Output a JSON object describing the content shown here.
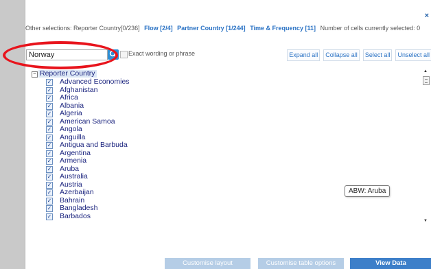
{
  "header": {
    "close_glyph": "×",
    "selections_prefix": "Other selections: Reporter Country[0/236]",
    "links": [
      "Flow [2/4]",
      "Partner Country [1/244]",
      "Time & Frequency [11]"
    ],
    "cells_selected": "Number of cells currently selected: 0"
  },
  "search": {
    "value": "Norway",
    "exact_label": "Exact wording or phrase"
  },
  "actions": [
    "Expand all",
    "Collapse all",
    "Select all",
    "Unselect all"
  ],
  "tree": {
    "root_label": "Reporter Country",
    "items": [
      "Advanced Economies",
      "Afghanistan",
      "Africa",
      "Albania",
      "Algeria",
      "American Samoa",
      "Angola",
      "Anguilla",
      "Antigua and Barbuda",
      "Argentina",
      "Armenia",
      "Aruba",
      "Australia",
      "Austria",
      "Azerbaijan",
      "Bahrain",
      "Bangladesh",
      "Barbados"
    ]
  },
  "tooltip": "ABW: Aruba",
  "footer": {
    "customise_layout": "Customise layout",
    "customise_table": "Customise table options",
    "view_data": "View Data"
  },
  "colors": {
    "link": "#2a72c4",
    "highlight_ring": "#e8141c",
    "primary_button": "#3d7fc9",
    "secondary_button": "#b5cde6"
  }
}
